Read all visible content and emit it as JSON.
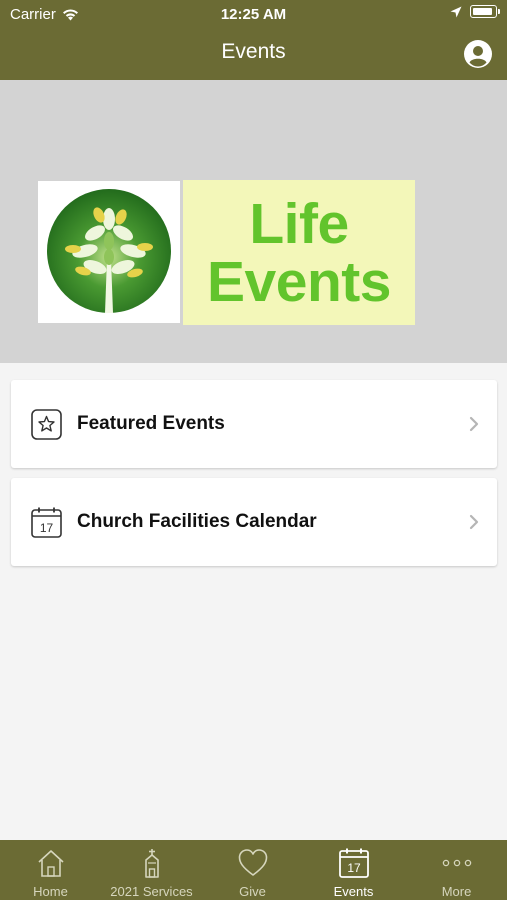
{
  "status_bar": {
    "carrier": "Carrier",
    "time": "12:25 AM"
  },
  "nav": {
    "title": "Events"
  },
  "banner": {
    "logo_line1": "Life",
    "logo_line2": "Events"
  },
  "list": [
    {
      "label": "Featured Events",
      "icon": "star-icon"
    },
    {
      "label": "Church Facilities Calendar",
      "icon": "calendar-icon",
      "icon_text": "17"
    }
  ],
  "tabs": [
    {
      "label": "Home",
      "icon": "home-icon"
    },
    {
      "label": "2021 Services",
      "icon": "church-icon"
    },
    {
      "label": "Give",
      "icon": "heart-icon"
    },
    {
      "label": "Events",
      "icon": "calendar-icon",
      "icon_text": "17",
      "active": true
    },
    {
      "label": "More",
      "icon": "more-dots-icon"
    }
  ],
  "colors": {
    "bar": "#6b6b34",
    "logo_green": "#62c42c",
    "logo_bg": "#f3f7b9",
    "banner_bg": "#d3d3d3"
  }
}
